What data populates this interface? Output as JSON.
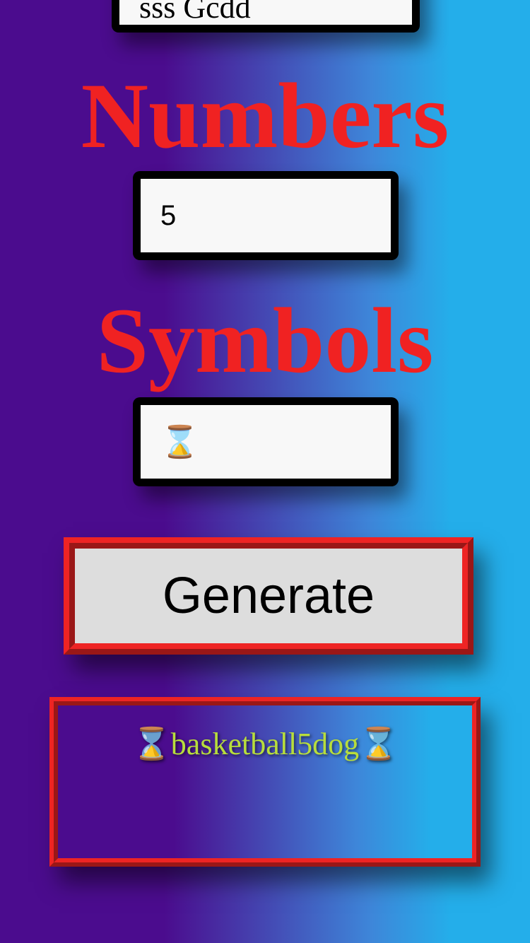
{
  "word_field": {
    "value": "sss Gcdd"
  },
  "numbers": {
    "heading": "Numbers",
    "value": "5"
  },
  "symbols": {
    "heading": "Symbols",
    "value": "⌛"
  },
  "generate_button": {
    "label": "Generate"
  },
  "result": {
    "password": "⌛basketball5dog⌛"
  },
  "colors": {
    "heading": "#f02222",
    "result_text": "#b8dd3c",
    "border_accent": "#ee2424",
    "gradient_left": "#4b0c8e",
    "gradient_right": "#24aeea"
  }
}
